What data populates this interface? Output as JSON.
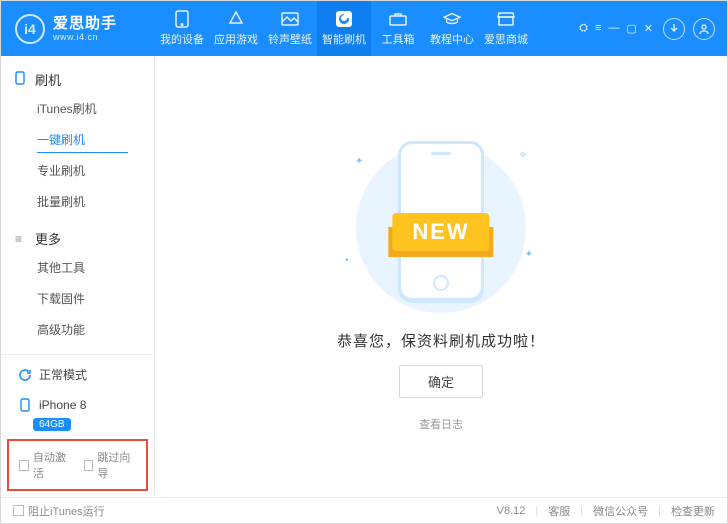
{
  "app": {
    "title": "爱思助手",
    "subtitle": "www.i4.cn",
    "logo_text": "i4"
  },
  "header": {
    "tabs": [
      {
        "label": "我的设备"
      },
      {
        "label": "应用游戏"
      },
      {
        "label": "铃声壁纸"
      },
      {
        "label": "智能刷机"
      },
      {
        "label": "工具箱"
      },
      {
        "label": "教程中心"
      },
      {
        "label": "爱思商城"
      }
    ],
    "active_tab": 3
  },
  "sidebar": {
    "groups": [
      {
        "title": "刷机",
        "icon": "phone",
        "items": [
          "iTunes刷机",
          "一键刷机",
          "专业刷机",
          "批量刷机"
        ],
        "active": 1
      },
      {
        "title": "更多",
        "icon": "menu",
        "items": [
          "其他工具",
          "下载固件",
          "高级功能"
        ],
        "active": -1
      }
    ],
    "mode": {
      "label": "正常模式"
    },
    "device": {
      "name": "iPhone 8",
      "storage": "64GB"
    },
    "checks": {
      "auto_activate": "自动激活",
      "skip_guide": "跳过向导"
    }
  },
  "main": {
    "ribbon": "NEW",
    "success": "恭喜您，保资料刷机成功啦！",
    "ok": "确定",
    "view_log": "查看日志"
  },
  "status": {
    "block_itunes": "阻止iTunes运行",
    "version": "V8.12",
    "support": "客服",
    "wechat": "微信公众号",
    "check_update": "检查更新"
  }
}
